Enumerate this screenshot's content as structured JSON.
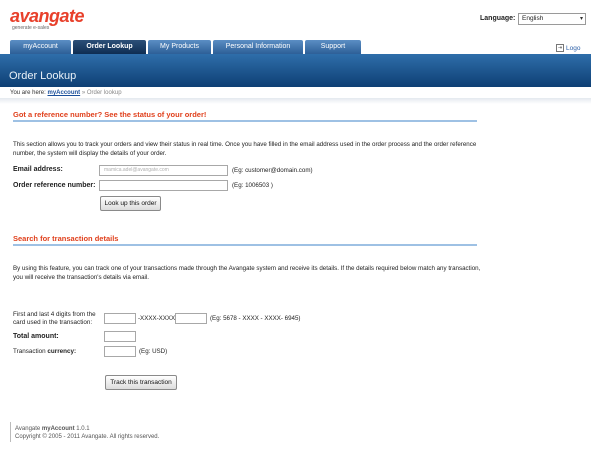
{
  "header": {
    "logo_text": "avangate",
    "logo_tagline": "generate e-sales",
    "language_label": "Language:",
    "language_value": "English",
    "logout_label": "Logo"
  },
  "tabs": [
    {
      "label": "myAccount",
      "active": false
    },
    {
      "label": "Order Lookup",
      "active": true
    },
    {
      "label": "My Products",
      "active": false
    },
    {
      "label": "Personal Information",
      "active": false
    },
    {
      "label": "Support",
      "active": false
    }
  ],
  "banner": {
    "title": "Order Lookup"
  },
  "breadcrumb": {
    "prefix": "You are here:",
    "link": "myAccount",
    "separator": "»",
    "current": "Order lookup"
  },
  "section_order": {
    "title": "Got a reference number? See the status of your order!",
    "description": "This section allows you to track your orders and view their status in real time. Once you have filled in the email address used in the order process and the order reference number, the system will display the details of your order.",
    "email_label": "Email address:",
    "email_value": "mamica.adel@avangate.com",
    "email_hint": "(Eg: customer@domain.com)",
    "ref_label": "Order reference number:",
    "ref_value": "",
    "ref_hint": "(Eg: 1006503 )",
    "button": "Look up this order"
  },
  "section_transaction": {
    "title": "Search for transaction details",
    "description": "By using this feature, you can track one of your transactions made through the Avangate system and receive its details. If the details required below match any transaction, you will receive the transaction's details via email.",
    "card_label_1": "First and last 4 digits from the",
    "card_label_2": "card used in the transaction:",
    "card_middle": "-XXXX-XXXX-",
    "card_hint": "(Eg: 5678 - XXXX - XXXX- 6945)",
    "amount_label": "Total amount:",
    "currency_label_prefix": "Transaction ",
    "currency_label_bold": "currency:",
    "currency_hint": "(Eg: USD)",
    "button": "Track this transaction"
  },
  "footer": {
    "line1_prefix": "Avangate ",
    "line1_bold": "myAccount",
    "line1_version": " 1.0.1",
    "line2": "Copyright © 2005 - 2011 Avangate. All rights reserved."
  }
}
